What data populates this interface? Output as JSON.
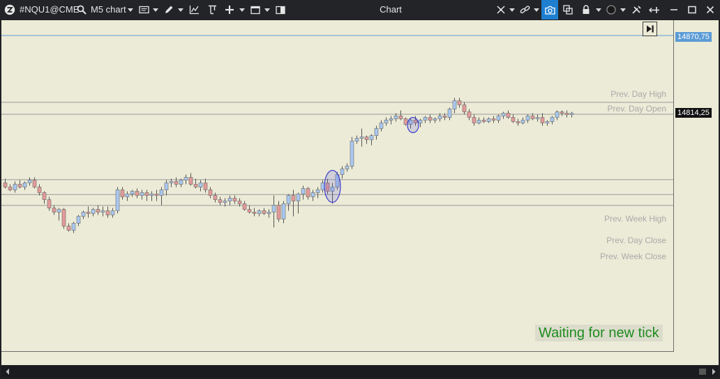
{
  "toolbar": {
    "symbol": "#NQU1@CME",
    "timeframe": "M5 chart",
    "title": "Chart"
  },
  "chart": {
    "levels": {
      "prev_day_high": "Prev. Day High",
      "prev_day_open": "Prev. Day Open",
      "prev_week_high": "Prev. Week High",
      "prev_day_close": "Prev. Day Close",
      "prev_week_close": "Prev. Week Close"
    },
    "price_labels": {
      "top_line": "14870,75",
      "current": "14814,25"
    },
    "status_message": "Waiting for new tick",
    "colors": {
      "background": "#ecebd7",
      "bull_candle": "#a9c8f0",
      "bear_candle": "#e49a9a",
      "level_line": "#9a9a9a",
      "top_line": "#5b9bd5",
      "status_text": "#1f8c1f",
      "highlight_ellipse": "#3c3cd0"
    }
  },
  "chart_data": {
    "type": "candlestick",
    "timeframe": "M5",
    "levels": [
      {
        "name": "Prev. Day High",
        "price": 14822.8
      },
      {
        "name": "Prev. Day Open",
        "price": 14814.25
      },
      {
        "name": "Prev. Week High",
        "price": 14767.3
      },
      {
        "name": "Prev. Day Close",
        "price": 14756.6
      },
      {
        "name": "Prev. Week Close",
        "price": 14748.8
      }
    ],
    "current_price": 14814.25,
    "top_line_price": 14870.75,
    "candles": [
      [
        14765,
        14768,
        14761,
        14762
      ],
      [
        14762,
        14764,
        14759,
        14760
      ],
      [
        14760,
        14766,
        14758,
        14764
      ],
      [
        14764,
        14767,
        14761,
        14762
      ],
      [
        14762,
        14766,
        14760,
        14765
      ],
      [
        14765,
        14769,
        14763,
        14767
      ],
      [
        14767,
        14769,
        14761,
        14762
      ],
      [
        14762,
        14764,
        14756,
        14758
      ],
      [
        14758,
        14759,
        14750,
        14753
      ],
      [
        14753,
        14755,
        14745,
        14747
      ],
      [
        14747,
        14749,
        14742,
        14744
      ],
      [
        14744,
        14747,
        14738,
        14746
      ],
      [
        14746,
        14747,
        14732,
        14734
      ],
      [
        14734,
        14736,
        14730,
        14731
      ],
      [
        14731,
        14737,
        14729,
        14736
      ],
      [
        14736,
        14742,
        14734,
        14741
      ],
      [
        14741,
        14745,
        14739,
        14744
      ],
      [
        14744,
        14748,
        14740,
        14743
      ],
      [
        14743,
        14747,
        14741,
        14746
      ],
      [
        14746,
        14749,
        14742,
        14744
      ],
      [
        14744,
        14748,
        14741,
        14745
      ],
      [
        14745,
        14748,
        14740,
        14742
      ],
      [
        14742,
        14747,
        14740,
        14745
      ],
      [
        14745,
        14762,
        14743,
        14760
      ],
      [
        14760,
        14762,
        14753,
        14755
      ],
      [
        14755,
        14759,
        14752,
        14757
      ],
      [
        14757,
        14760,
        14755,
        14759
      ],
      [
        14759,
        14761,
        14754,
        14756
      ],
      [
        14756,
        14760,
        14753,
        14758
      ],
      [
        14758,
        14760,
        14752,
        14756
      ],
      [
        14756,
        14759,
        14752,
        14757
      ],
      [
        14757,
        14760,
        14752,
        14756
      ],
      [
        14756,
        14762,
        14749,
        14760
      ],
      [
        14760,
        14767,
        14756,
        14765
      ],
      [
        14765,
        14768,
        14762,
        14766
      ],
      [
        14766,
        14769,
        14762,
        14764
      ],
      [
        14764,
        14768,
        14762,
        14767
      ],
      [
        14767,
        14771,
        14764,
        14769
      ],
      [
        14769,
        14772,
        14763,
        14764
      ],
      [
        14764,
        14768,
        14761,
        14762
      ],
      [
        14762,
        14767,
        14759,
        14765
      ],
      [
        14765,
        14768,
        14758,
        14760
      ],
      [
        14760,
        14762,
        14754,
        14756
      ],
      [
        14756,
        14758,
        14751,
        14753
      ],
      [
        14753,
        14755,
        14749,
        14751
      ],
      [
        14751,
        14754,
        14748,
        14752
      ],
      [
        14752,
        14756,
        14749,
        14754
      ],
      [
        14754,
        14756,
        14750,
        14752
      ],
      [
        14752,
        14754,
        14748,
        14750
      ],
      [
        14750,
        14752,
        14745,
        14746
      ],
      [
        14746,
        14749,
        14743,
        14744
      ],
      [
        14744,
        14747,
        14741,
        14743
      ],
      [
        14743,
        14746,
        14741,
        14745
      ],
      [
        14745,
        14747,
        14742,
        14743
      ],
      [
        14743,
        14746,
        14740,
        14744
      ],
      [
        14744,
        14756,
        14733,
        14749
      ],
      [
        14749,
        14752,
        14737,
        14739
      ],
      [
        14739,
        14752,
        14736,
        14750
      ],
      [
        14750,
        14757,
        14745,
        14756
      ],
      [
        14756,
        14760,
        14741,
        14752
      ],
      [
        14752,
        14758,
        14743,
        14757
      ],
      [
        14757,
        14763,
        14753,
        14761
      ],
      [
        14761,
        14762,
        14753,
        14755
      ],
      [
        14755,
        14760,
        14752,
        14758
      ],
      [
        14758,
        14762,
        14754,
        14760
      ],
      [
        14760,
        14767,
        14758,
        14765
      ],
      [
        14765,
        14768,
        14757,
        14759
      ],
      [
        14759,
        14765,
        14750,
        14762
      ],
      [
        14762,
        14773,
        14760,
        14771
      ],
      [
        14771,
        14777,
        14768,
        14775
      ],
      [
        14775,
        14779,
        14773,
        14777
      ],
      [
        14777,
        14798,
        14775,
        14795
      ],
      [
        14795,
        14799,
        14793,
        14797
      ],
      [
        14797,
        14804,
        14791,
        14798
      ],
      [
        14798,
        14799,
        14793,
        14796
      ],
      [
        14796,
        14800,
        14792,
        14799
      ],
      [
        14799,
        14806,
        14796,
        14804
      ],
      [
        14804,
        14810,
        14802,
        14808
      ],
      [
        14808,
        14812,
        14806,
        14810
      ],
      [
        14810,
        14813,
        14807,
        14811
      ],
      [
        14811,
        14815,
        14809,
        14813
      ],
      [
        14813,
        14817,
        14810,
        14811
      ],
      [
        14811,
        14812,
        14806,
        14807
      ],
      [
        14807,
        14811,
        14804,
        14810
      ],
      [
        14810,
        14813,
        14806,
        14808
      ],
      [
        14808,
        14811,
        14805,
        14810
      ],
      [
        14810,
        14813,
        14808,
        14812
      ],
      [
        14812,
        14814,
        14808,
        14810
      ],
      [
        14810,
        14812,
        14808,
        14811
      ],
      [
        14811,
        14815,
        14809,
        14813
      ],
      [
        14813,
        14815,
        14810,
        14812
      ],
      [
        14812,
        14819,
        14810,
        14818
      ],
      [
        14818,
        14826,
        14815,
        14824
      ],
      [
        14824,
        14826,
        14819,
        14821
      ],
      [
        14821,
        14823,
        14814,
        14816
      ],
      [
        14816,
        14818,
        14810,
        14812
      ],
      [
        14812,
        14814,
        14806,
        14808
      ],
      [
        14808,
        14812,
        14807,
        14810
      ],
      [
        14810,
        14812,
        14808,
        14809
      ],
      [
        14809,
        14812,
        14808,
        14811
      ],
      [
        14811,
        14813,
        14808,
        14810
      ],
      [
        14810,
        14814,
        14808,
        14813
      ],
      [
        14813,
        14816,
        14811,
        14815
      ],
      [
        14815,
        14817,
        14811,
        14812
      ],
      [
        14812,
        14814,
        14808,
        14809
      ],
      [
        14809,
        14811,
        14806,
        14808
      ],
      [
        14808,
        14812,
        14807,
        14810
      ],
      [
        14810,
        14814,
        14808,
        14813
      ],
      [
        14813,
        14815,
        14810,
        14811
      ],
      [
        14811,
        14814,
        14809,
        14812
      ],
      [
        14812,
        14815,
        14806,
        14808
      ],
      [
        14808,
        14810,
        14806,
        14809
      ],
      [
        14809,
        14813,
        14807,
        14812
      ],
      [
        14812,
        14817,
        14810,
        14816
      ],
      [
        14816,
        14817,
        14813,
        14815
      ],
      [
        14815,
        14817,
        14812,
        14814
      ],
      [
        14814,
        14816,
        14812,
        14815
      ]
    ]
  }
}
